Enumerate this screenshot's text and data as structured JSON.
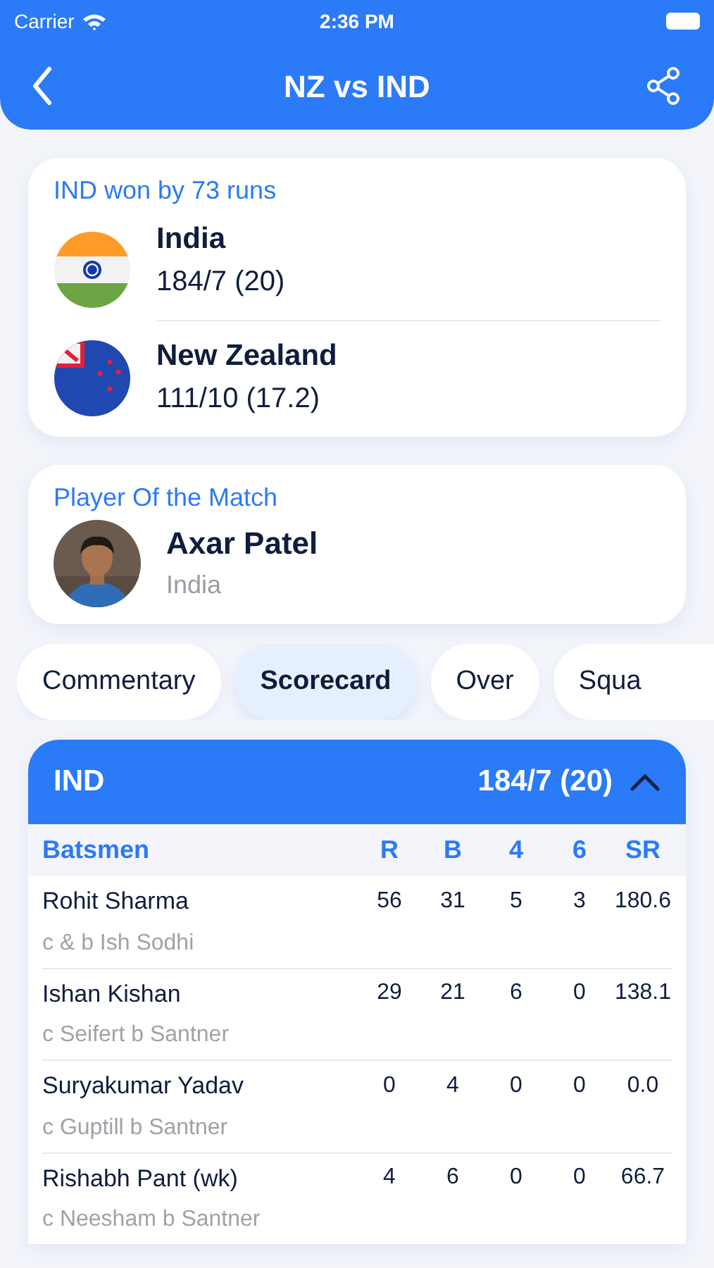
{
  "status_bar": {
    "carrier": "Carrier",
    "time": "2:36 PM"
  },
  "header": {
    "title": "NZ vs IND"
  },
  "result": {
    "summary": "IND won by 73 runs",
    "teams": [
      {
        "name": "India",
        "score": "184/7 (20)",
        "kind": "india"
      },
      {
        "name": "New Zealand",
        "score": "111/10 (17.2)",
        "kind": "new_zealand"
      }
    ]
  },
  "player_of_match": {
    "heading": "Player Of the Match",
    "name": "Axar Patel",
    "country": "India"
  },
  "tabs": [
    {
      "label": "Commentary",
      "selected": false
    },
    {
      "label": "Scorecard",
      "selected": true
    },
    {
      "label": "Over",
      "selected": false
    },
    {
      "label": "Squa",
      "selected": false
    }
  ],
  "innings": {
    "team": "IND",
    "score": "184/7 (20)",
    "expanded": true,
    "columns": [
      "Batsmen",
      "R",
      "B",
      "4",
      "6",
      "SR"
    ],
    "rows": [
      {
        "name": "Rohit Sharma",
        "dismissal": "c & b Ish Sodhi",
        "stats": [
          "56",
          "31",
          "5",
          "3",
          "180.6"
        ]
      },
      {
        "name": "Ishan Kishan",
        "dismissal": "c Seifert b Santner",
        "stats": [
          "29",
          "21",
          "6",
          "0",
          "138.1"
        ]
      },
      {
        "name": "Suryakumar Yadav",
        "dismissal": "c Guptill b Santner",
        "stats": [
          "0",
          "4",
          "0",
          "0",
          "0.0"
        ]
      },
      {
        "name": "Rishabh Pant (wk)",
        "dismissal": "c Neesham b Santner",
        "stats": [
          "4",
          "6",
          "0",
          "0",
          "66.7"
        ]
      }
    ]
  }
}
